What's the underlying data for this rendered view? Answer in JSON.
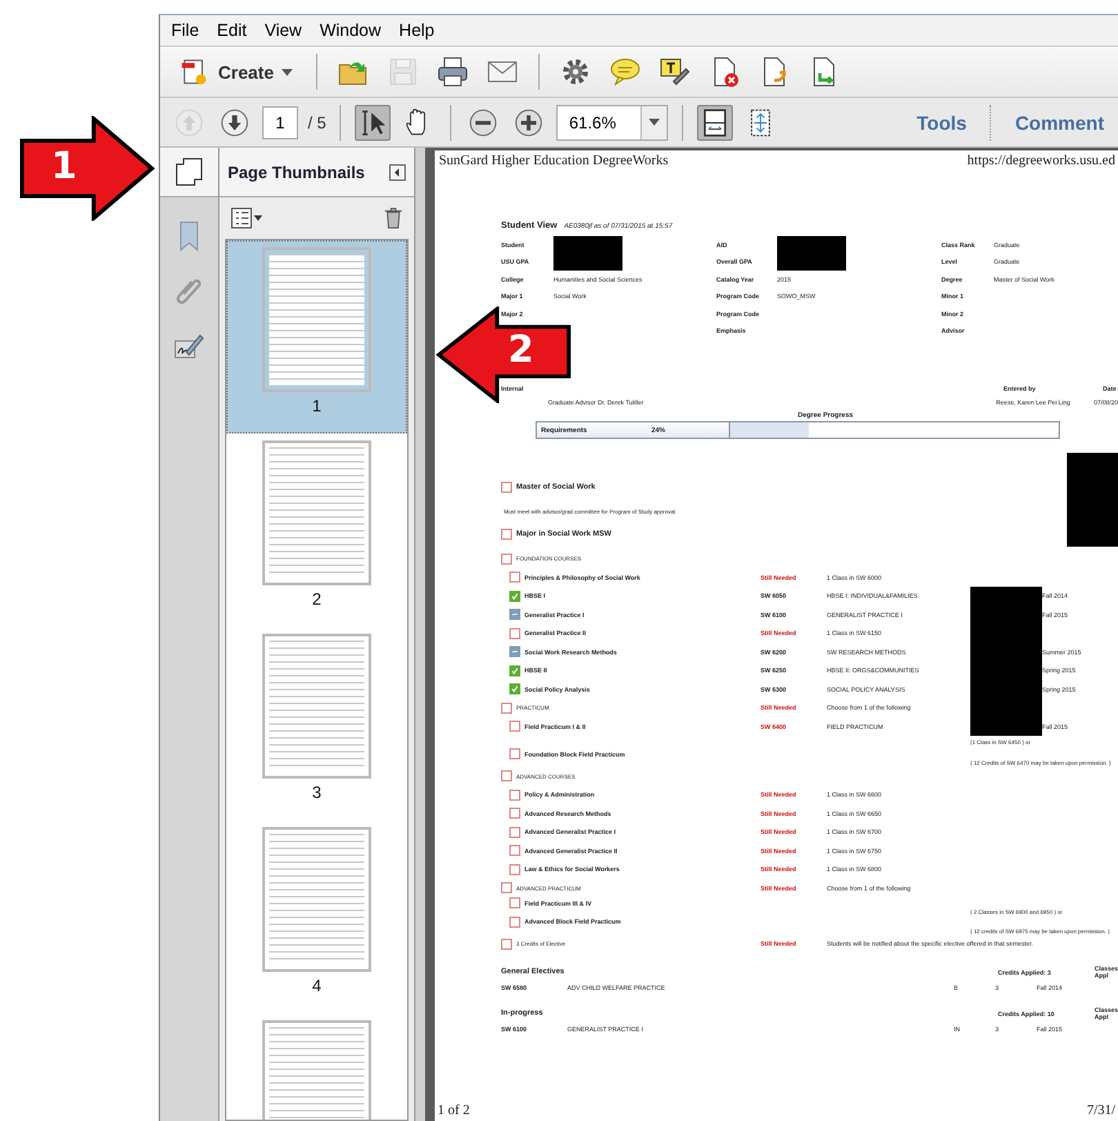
{
  "menu": [
    "File",
    "Edit",
    "View",
    "Window",
    "Help"
  ],
  "toolbar": {
    "create": "Create",
    "groups": [
      [
        {
          "kind": "open",
          "disabled": false
        },
        {
          "kind": "save",
          "disabled": true
        },
        {
          "kind": "print",
          "disabled": false
        },
        {
          "kind": "mail",
          "disabled": false
        }
      ],
      [
        {
          "kind": "gear",
          "disabled": false
        },
        {
          "kind": "comment",
          "disabled": false
        },
        {
          "kind": "highlight",
          "disabled": false
        },
        {
          "kind": "doc-delete",
          "disabled": false
        },
        {
          "kind": "doc-sign",
          "disabled": false
        },
        {
          "kind": "doc-export",
          "disabled": false
        }
      ]
    ]
  },
  "navbar": {
    "prev_disabled": true,
    "next_disabled": false,
    "page": "1",
    "page_count": "/ 5",
    "tools": [
      {
        "kind": "select",
        "selected": true
      },
      {
        "kind": "hand",
        "selected": false
      }
    ],
    "zoom": "61.6%",
    "views": [
      {
        "kind": "fit-page",
        "selected": true
      },
      {
        "kind": "fit-width",
        "selected": false
      }
    ],
    "links": [
      "Tools",
      "Comment"
    ]
  },
  "sidebar": {
    "title": "Page Thumbnails",
    "icons": [
      {
        "kind": "bookmark"
      },
      {
        "kind": "paperclip"
      },
      {
        "kind": "signature"
      }
    ],
    "thumbnails": [
      {
        "label": "1",
        "selected": true
      },
      {
        "label": "2",
        "selected": false
      },
      {
        "label": "3",
        "selected": false
      },
      {
        "label": "4",
        "selected": false
      },
      {
        "selected": false
      }
    ]
  },
  "document": {
    "header_left": "SunGard Higher Education DegreeWorks",
    "header_right": "https://degreeworks.usu.ed",
    "view_title": "Student View",
    "view_subtitle": "AE0380jf as of 07/31/2015 at 15:57",
    "info_columns": [
      [
        {
          "label": "Student",
          "redacted": true
        },
        {
          "label": "USU GPA",
          "redacted": true
        },
        {
          "label": "College",
          "value": "Humanities and Social Sciences"
        },
        {
          "label": "Major 1",
          "value": "Social Work"
        },
        {
          "label": "Major 2"
        }
      ],
      [
        {
          "label": "AID",
          "redacted": true
        },
        {
          "label": "Overall GPA",
          "redacted": true
        },
        {
          "label": "Catalog Year",
          "value": "2015"
        },
        {
          "label": "Program Code",
          "value": "SOWO_MSW"
        },
        {
          "label": "Program Code"
        },
        {
          "label": "Emphasis"
        }
      ],
      [
        {
          "label": "Class Rank",
          "value": "Graduate"
        },
        {
          "label": "Level",
          "value": "Graduate"
        },
        {
          "label": "Degree",
          "value": "Master of Social Work"
        },
        {
          "label": "Minor 1"
        },
        {
          "label": "Minor 2"
        },
        {
          "label": "Advisor"
        }
      ]
    ],
    "internal": {
      "title": "Internal",
      "note": "Graduate Advisor Dr. Derek Tuliller",
      "entered_by_label": "Entered by",
      "entered_by": "Reese, Karen Lee Pei Ling",
      "date_label": "Date",
      "date": "07/08/20"
    },
    "progress": {
      "title": "Degree Progress",
      "label": "Requirements",
      "percent": "24%",
      "level": 0.24
    },
    "requirements": [
      {
        "kind": "degree",
        "name": "Master of Social Work",
        "checked": false,
        "redacted": true,
        "note": "Must meet with advisor/grad committee for Program of Study approval."
      },
      {
        "kind": "major",
        "name": "Major in Social Work MSW",
        "checked": false,
        "children": [
          {
            "kind": "block",
            "name": "FOUNDATION COURSES",
            "checked": false,
            "children": [
              {
                "kind": "rule",
                "name": "Principles & Philosophy of Social Work",
                "checked": false,
                "course": "Still Needed",
                "title": "1 Class in SW 6000"
              },
              {
                "kind": "rule",
                "name": "HBSE I",
                "checked": true,
                "course": "SW 6050",
                "title": "HBSE I: INDIVIDUAL&FAMILIES",
                "term": "Fall 2014",
                "redacted": true
              },
              {
                "kind": "rule",
                "name": "Generalist Practice I",
                "in_progress": true,
                "course": "SW 6100",
                "title": "GENERALIST PRACTICE I",
                "term": "Fall 2015",
                "redacted": true
              },
              {
                "kind": "rule",
                "name": "Generalist Practice II",
                "checked": false,
                "course": "Still Needed",
                "title": "1 Class in SW 6150",
                "redacted": true
              },
              {
                "kind": "rule",
                "name": "Social Work Research Methods",
                "in_progress": true,
                "course": "SW 6200",
                "title": "SW RESEARCH METHODS",
                "term": "Summer 2015",
                "redacted": true
              },
              {
                "kind": "rule",
                "name": "HBSE II",
                "checked": true,
                "course": "SW 6250",
                "title": "HBSE II: ORGS&COMMUNITIES",
                "term": "Spring 2015",
                "redacted": true
              },
              {
                "kind": "rule",
                "name": "Social Policy Analysis",
                "checked": true,
                "course": "SW 6300",
                "title": "SOCIAL POLICY ANALYSIS",
                "term": "Spring 2015",
                "redacted": true
              }
            ]
          },
          {
            "kind": "block",
            "name": "PRACTICUM",
            "checked": false,
            "course": "Still Needed",
            "title": "Choose from 1 of the following",
            "redacted": true,
            "children": [
              {
                "kind": "rule",
                "name": "Field Practicum I & II",
                "checked": false,
                "course": "SW 6400",
                "title": "FIELD PRACTICUM",
                "term": "Fall 2015",
                "extra": "(1 Class in SW 6450 ) or",
                "redacted": true
              },
              {
                "kind": "rule",
                "name": "Foundation Block Field Practicum",
                "checked": false,
                "extra": "( 12 Credits of SW 6470 may be taken upon permission. )"
              }
            ]
          },
          {
            "kind": "block",
            "name": "ADVANCED COURSES",
            "checked": false,
            "children": [
              {
                "kind": "rule",
                "name": "Policy & Administration",
                "checked": false,
                "course": "Still Needed",
                "title": "1 Class in SW 6600"
              },
              {
                "kind": "rule",
                "name": "Advanced Research Methods",
                "checked": false,
                "course": "Still Needed",
                "title": "1 Class in SW 6650"
              },
              {
                "kind": "rule",
                "name": "Advanced Generalist Practice I",
                "checked": false,
                "course": "Still Needed",
                "title": "1 Class in SW 6700"
              },
              {
                "kind": "rule",
                "name": "Advanced Generalist Practice II",
                "checked": false,
                "course": "Still Needed",
                "title": "1 Class in SW 6750"
              },
              {
                "kind": "rule",
                "name": "Law & Ethics for Social Workers",
                "checked": false,
                "course": "Still Needed",
                "title": "1 Class in SW 6800"
              }
            ]
          },
          {
            "kind": "block",
            "name": "ADVANCED PRACTICUM",
            "checked": false,
            "course": "Still Needed",
            "title": "Choose from 1 of the following",
            "children": [
              {
                "kind": "rule",
                "name": "Field Practicum III & IV",
                "checked": false,
                "extra": "( 2 Classes in SW 6900 and 6950 ) or"
              },
              {
                "kind": "rule",
                "name": "Advanced Block Field Practicum",
                "checked": false,
                "extra": "( 12 credits of SW 6975 may be taken upon permission. )"
              }
            ]
          },
          {
            "kind": "block",
            "name": "3 Credits of Elective",
            "checked": false,
            "course": "Still Needed",
            "title": "Students will be notified about the specific elective offered in that semester."
          }
        ]
      }
    ],
    "sections": [
      {
        "title": "General Electives",
        "credits": "Credits Applied: 3",
        "classes": "Classes Appl",
        "courses": [
          {
            "course": "SW 6580",
            "title": "ADV CHILD WELFARE PRACTICE",
            "grade": "B",
            "credits": "3",
            "term": "Fall 2014"
          }
        ]
      },
      {
        "title": "In-progress",
        "credits": "Credits Applied: 10",
        "classes": "Classes Appl",
        "courses": [
          {
            "course": "SW 6100",
            "title": "GENERALIST PRACTICE I",
            "grade": "IN",
            "credits": "3",
            "term": "Fall 2015"
          }
        ]
      }
    ],
    "footer_left": "1 of 2",
    "footer_right": "7/31/"
  },
  "callouts": [
    {
      "label": "1",
      "kind": "right"
    },
    {
      "label": "2",
      "kind": "left"
    }
  ]
}
